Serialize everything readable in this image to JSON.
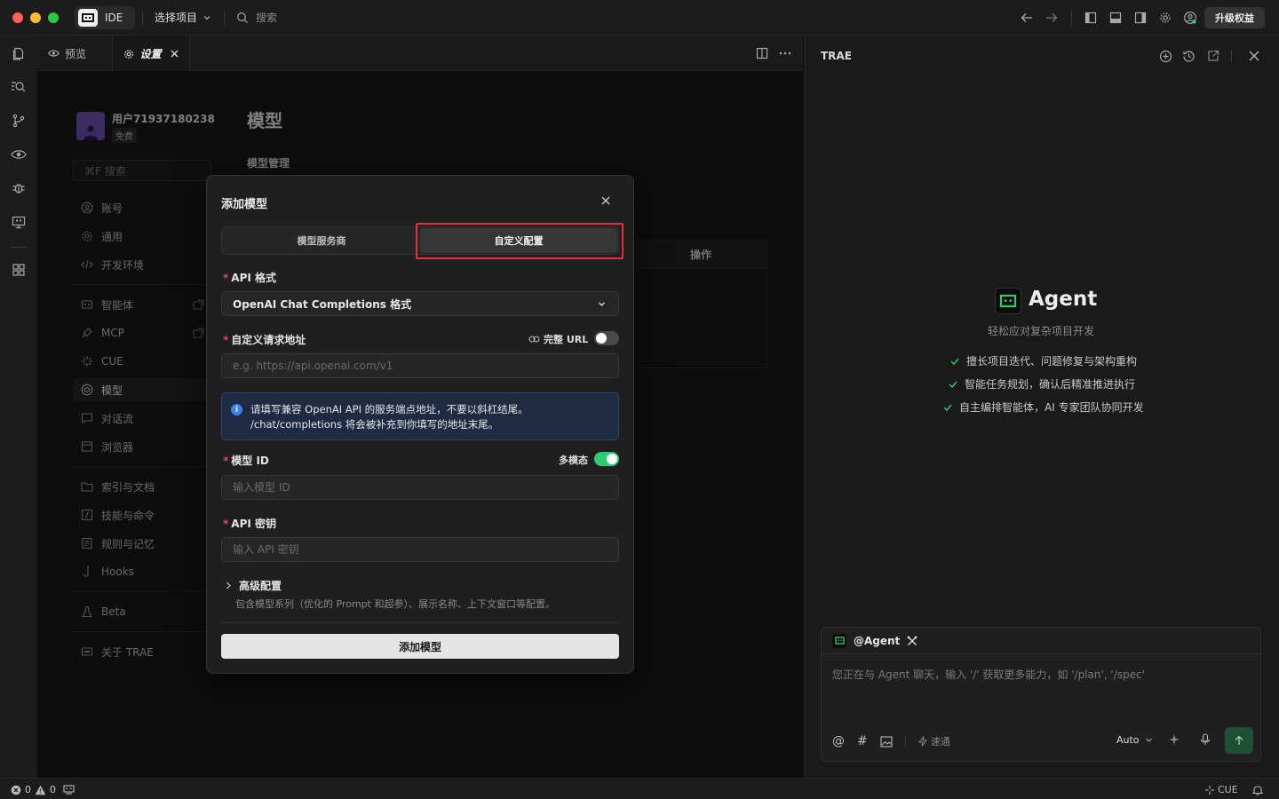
{
  "titlebar": {
    "ide_label": "IDE",
    "project_label": "选择项目",
    "search_placeholder": "搜索",
    "upgrade_label": "升级权益"
  },
  "tabs": [
    {
      "label": "预览",
      "icon": "eye-icon"
    },
    {
      "label": "设置",
      "icon": "gear-icon"
    }
  ],
  "settings": {
    "user_name": "用户71937180238",
    "plan_badge": "免费",
    "search_placeholder": "⌘F 搜索",
    "page_title": "模型",
    "section_title": "模型管理",
    "table_action_header": "操作",
    "menu": [
      {
        "label": "账号",
        "icon": "user-circle-icon"
      },
      {
        "label": "通用",
        "icon": "gear-icon"
      },
      {
        "label": "开发环境",
        "icon": "code-icon"
      },
      {
        "label": "智能体",
        "icon": "bot-icon"
      },
      {
        "label": "MCP",
        "icon": "plug-icon"
      },
      {
        "label": "CUE",
        "icon": "sparkle-icon"
      },
      {
        "label": "模型",
        "icon": "model-icon"
      },
      {
        "label": "对话流",
        "icon": "chat-icon"
      },
      {
        "label": "浏览器",
        "icon": "browser-icon"
      },
      {
        "label": "索引与文档",
        "icon": "folder-icon"
      },
      {
        "label": "技能与命令",
        "icon": "skill-icon"
      },
      {
        "label": "规则与记忆",
        "icon": "book-icon"
      },
      {
        "label": "Hooks",
        "icon": "hook-icon"
      },
      {
        "label": "Beta",
        "icon": "flask-icon"
      },
      {
        "label": "关于 TRAE",
        "icon": "info-card-icon"
      }
    ]
  },
  "modal": {
    "title": "添加模型",
    "tab_provider": "模型服务商",
    "tab_custom": "自定义配置",
    "api_format_label": "API 格式",
    "api_format_value": "OpenAI Chat Completions 格式",
    "url_label": "自定义请求地址",
    "full_url_label": "完整 URL",
    "url_placeholder": "e.g. https://api.openai.com/v1",
    "info_line1": "请填写兼容 OpenAI API 的服务端点地址，不要以斜杠结尾。",
    "info_line2": "/chat/completions 将会被补充到你填写的地址末尾。",
    "model_id_label": "模型 ID",
    "multimodal_label": "多模态",
    "model_id_placeholder": "输入模型 ID",
    "api_key_label": "API 密钥",
    "api_key_placeholder": "输入 API 密钥",
    "advanced_label": "高级配置",
    "advanced_desc": "包含模型系列（优化的 Prompt 和超参）、展示名称、上下文窗口等配置。",
    "submit_label": "添加模型"
  },
  "right_panel": {
    "title": "TRAE",
    "agent_title": "Agent",
    "agent_subtitle": "轻松应对复杂项目开发",
    "features": [
      "擅长项目迭代、问题修复与架构重构",
      "智能任务规划，确认后精准推进执行",
      "自主编排智能体，AI 专家团队协同开发"
    ],
    "chat_agent_label": "@Agent",
    "chat_placeholder": "您正在与 Agent 聊天，输入 '/' 获取更多能力，如 '/plan', '/spec'",
    "speed_label": "速通",
    "model_select": "Auto"
  },
  "statusbar": {
    "errors": "0",
    "warnings": "0",
    "cue_label": "CUE"
  },
  "colors": {
    "accent_green": "#2ecc71",
    "highlight_red": "#e0303a",
    "info_blue": "#3b82f6"
  }
}
